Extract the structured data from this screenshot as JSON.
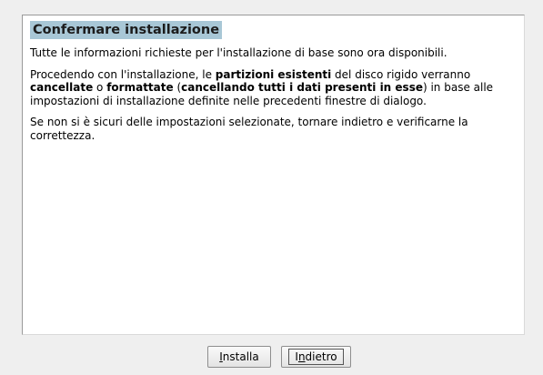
{
  "panel": {
    "heading": "Confermare installazione",
    "para1": "Tutte le informazioni richieste per l'installazione di base sono ora disponibili.",
    "para2": {
      "t1": "Procedendo con l'installazione, le ",
      "b1": "partizioni esistenti",
      "t2": " del disco rigido verranno ",
      "b2": "cancellate",
      "t3": " o ",
      "b3": "formattate",
      "t4": " (",
      "b4": "cancellando tutti i dati presenti in esse",
      "t5": ") in base alle impostazioni di installazione definite nelle precedenti finestre di dialogo."
    },
    "para3": "Se non si è sicuri delle impostazioni selezionate, tornare indietro e verificarne la correttezza."
  },
  "buttons": {
    "install": {
      "accel": "I",
      "rest": "nstalla"
    },
    "back": {
      "pre": "I",
      "accel": "n",
      "rest": "dietro"
    }
  }
}
